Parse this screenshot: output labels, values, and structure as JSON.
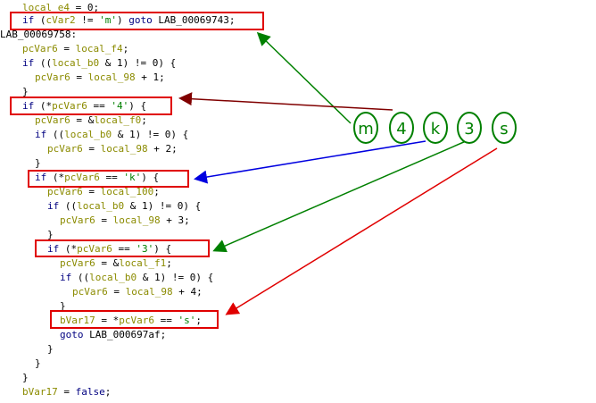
{
  "code_lines": [
    {
      "indent": "  ",
      "tokens": [
        [
          "v",
          "local_e4"
        ],
        [
          "n",
          " = 0;"
        ]
      ]
    },
    {
      "indent": "  ",
      "tokens": [
        [
          "kw",
          "if"
        ],
        [
          "n",
          " ("
        ],
        [
          "v",
          "cVar2"
        ],
        [
          "n",
          " != "
        ],
        [
          "s",
          "'m'"
        ],
        [
          "n",
          ") "
        ],
        [
          "kw",
          "goto"
        ],
        [
          "n",
          " LAB_00069743;"
        ]
      ]
    },
    {
      "indent": "",
      "tokens": [
        [
          "n",
          "LAB_00069758:"
        ]
      ]
    },
    {
      "indent": "  ",
      "tokens": [
        [
          "v",
          "pcVar6"
        ],
        [
          "n",
          " = "
        ],
        [
          "v",
          "local_f4"
        ],
        [
          "n",
          ";"
        ]
      ]
    },
    {
      "indent": "  ",
      "tokens": [
        [
          "kw",
          "if"
        ],
        [
          "n",
          " (("
        ],
        [
          "v",
          "local_b0"
        ],
        [
          "n",
          " & 1) != 0) {"
        ]
      ]
    },
    {
      "indent": "    ",
      "tokens": [
        [
          "v",
          "pcVar6"
        ],
        [
          "n",
          " = "
        ],
        [
          "v",
          "local_98"
        ],
        [
          "n",
          " + 1;"
        ]
      ]
    },
    {
      "indent": "  ",
      "tokens": [
        [
          "n",
          "}"
        ]
      ]
    },
    {
      "indent": "  ",
      "tokens": [
        [
          "kw",
          "if"
        ],
        [
          "n",
          " (*"
        ],
        [
          "v",
          "pcVar6"
        ],
        [
          "n",
          " == "
        ],
        [
          "s",
          "'4'"
        ],
        [
          "n",
          ") {"
        ]
      ]
    },
    {
      "indent": "    ",
      "tokens": [
        [
          "v",
          "pcVar6"
        ],
        [
          "n",
          " = &"
        ],
        [
          "v",
          "local_f0"
        ],
        [
          "n",
          ";"
        ]
      ]
    },
    {
      "indent": "    ",
      "tokens": [
        [
          "kw",
          "if"
        ],
        [
          "n",
          " (("
        ],
        [
          "v",
          "local_b0"
        ],
        [
          "n",
          " & 1) != 0) {"
        ]
      ]
    },
    {
      "indent": "      ",
      "tokens": [
        [
          "v",
          "pcVar6"
        ],
        [
          "n",
          " = "
        ],
        [
          "v",
          "local_98"
        ],
        [
          "n",
          " + 2;"
        ]
      ]
    },
    {
      "indent": "    ",
      "tokens": [
        [
          "n",
          "}"
        ]
      ]
    },
    {
      "indent": "    ",
      "tokens": [
        [
          "kw",
          "if"
        ],
        [
          "n",
          " (*"
        ],
        [
          "v",
          "pcVar6"
        ],
        [
          "n",
          " == "
        ],
        [
          "s",
          "'k'"
        ],
        [
          "n",
          ") {"
        ]
      ]
    },
    {
      "indent": "      ",
      "tokens": [
        [
          "v",
          "pcVar6"
        ],
        [
          "n",
          " = "
        ],
        [
          "v",
          "local_100"
        ],
        [
          "n",
          ";"
        ]
      ]
    },
    {
      "indent": "      ",
      "tokens": [
        [
          "kw",
          "if"
        ],
        [
          "n",
          " (("
        ],
        [
          "v",
          "local_b0"
        ],
        [
          "n",
          " & 1) != 0) {"
        ]
      ]
    },
    {
      "indent": "        ",
      "tokens": [
        [
          "v",
          "pcVar6"
        ],
        [
          "n",
          " = "
        ],
        [
          "v",
          "local_98"
        ],
        [
          "n",
          " + 3;"
        ]
      ]
    },
    {
      "indent": "      ",
      "tokens": [
        [
          "n",
          "}"
        ]
      ]
    },
    {
      "indent": "      ",
      "tokens": [
        [
          "kw",
          "if"
        ],
        [
          "n",
          " (*"
        ],
        [
          "v",
          "pcVar6"
        ],
        [
          "n",
          " == "
        ],
        [
          "s",
          "'3'"
        ],
        [
          "n",
          ") {"
        ]
      ]
    },
    {
      "indent": "        ",
      "tokens": [
        [
          "v",
          "pcVar6"
        ],
        [
          "n",
          " = &"
        ],
        [
          "v",
          "local_f1"
        ],
        [
          "n",
          ";"
        ]
      ]
    },
    {
      "indent": "        ",
      "tokens": [
        [
          "kw",
          "if"
        ],
        [
          "n",
          " (("
        ],
        [
          "v",
          "local_b0"
        ],
        [
          "n",
          " & 1) != 0) {"
        ]
      ]
    },
    {
      "indent": "          ",
      "tokens": [
        [
          "v",
          "pcVar6"
        ],
        [
          "n",
          " = "
        ],
        [
          "v",
          "local_98"
        ],
        [
          "n",
          " + 4;"
        ]
      ]
    },
    {
      "indent": "        ",
      "tokens": [
        [
          "n",
          "}"
        ]
      ]
    },
    {
      "indent": "        ",
      "tokens": [
        [
          "v",
          "bVar17"
        ],
        [
          "n",
          " = *"
        ],
        [
          "v",
          "pcVar6"
        ],
        [
          "n",
          " == "
        ],
        [
          "s",
          "'s'"
        ],
        [
          "n",
          ";"
        ]
      ]
    },
    {
      "indent": "        ",
      "tokens": [
        [
          "kw",
          "goto"
        ],
        [
          "n",
          " LAB_000697af;"
        ]
      ]
    },
    {
      "indent": "      ",
      "tokens": [
        [
          "n",
          "}"
        ]
      ]
    },
    {
      "indent": "    ",
      "tokens": [
        [
          "n",
          "}"
        ]
      ]
    },
    {
      "indent": "  ",
      "tokens": [
        [
          "n",
          "}"
        ]
      ]
    },
    {
      "indent": "  ",
      "tokens": [
        [
          "v",
          "bVar17"
        ],
        [
          "n",
          " = "
        ],
        [
          "kw",
          "false"
        ],
        [
          "n",
          ";"
        ]
      ]
    }
  ],
  "circles": [
    {
      "label": "m",
      "color": "#008000"
    },
    {
      "label": "4",
      "color": "#008000"
    },
    {
      "label": "k",
      "color": "#008000"
    },
    {
      "label": "3",
      "color": "#008000"
    },
    {
      "label": "s",
      "color": "#008000"
    }
  ],
  "arrow_colors": [
    "#008000",
    "#800000",
    "#0000e0",
    "#008000",
    "#e00000"
  ],
  "highlight_color": "#e00000"
}
